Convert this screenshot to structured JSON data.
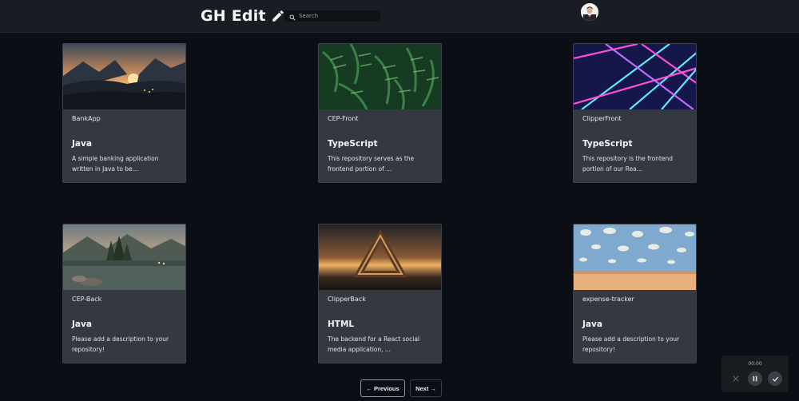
{
  "header": {
    "title": "GH Edit",
    "search_placeholder": "Search"
  },
  "repos": [
    {
      "name": "BankApp",
      "language": "Java",
      "description": "A simple banking application written in Java to be..."
    },
    {
      "name": "CEP-Front",
      "language": "TypeScript",
      "description": "This repository serves as the frontend portion of ..."
    },
    {
      "name": "ClipperFront",
      "language": "TypeScript",
      "description": "This repository is the frontend portion of our Rea..."
    },
    {
      "name": "CEP-Back",
      "language": "Java",
      "description": "Please add a description to your repository!"
    },
    {
      "name": "ClipperBack",
      "language": "HTML",
      "description": "The backend for a React social media application, ..."
    },
    {
      "name": "expense-tracker",
      "language": "Java",
      "description": "Please add a description to your repository!"
    }
  ],
  "pagination": {
    "previous_label": "← Previous",
    "next_label": "Next →"
  },
  "recorder": {
    "time": "00:00"
  }
}
